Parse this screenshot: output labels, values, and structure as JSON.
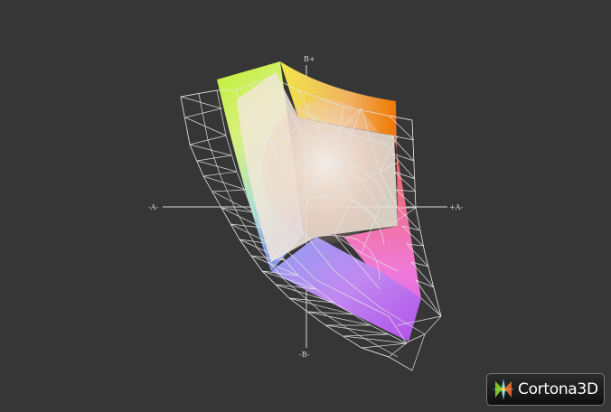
{
  "viewer": {
    "background_color": "#363636",
    "wireframe_color": "#e6e6e6",
    "axis_color": "#d8d8d8"
  },
  "axes": {
    "plus_b": "B+",
    "minus_b": "-B-",
    "plus_a": "+A-",
    "minus_a": "-A-"
  },
  "branding": {
    "name": "Cortona",
    "suffix": "3D",
    "icon": "cortona-star-icon"
  }
}
